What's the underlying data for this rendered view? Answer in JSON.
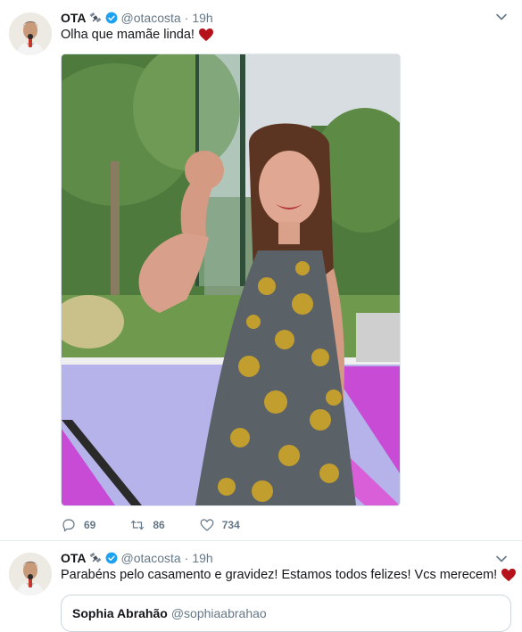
{
  "tweets": [
    {
      "name": "OTA",
      "handle": "@otacosta",
      "separator": "·",
      "time": "19h",
      "text": "Olha que mamãe linda!",
      "counts": {
        "replies": "69",
        "retweets": "86",
        "likes": "734"
      }
    },
    {
      "name": "OTA",
      "handle": "@otacosta",
      "separator": "·",
      "time": "19h",
      "text": "Parabéns pelo casamento e gravidez! Estamos todos felizes! Vcs merecem!",
      "quote": {
        "name": "Sophia Abrahão",
        "handle": "@sophiaabrahao"
      }
    }
  ],
  "colors": {
    "verified": "#1da1f2",
    "heart": "#b5121b",
    "meta": "#657786",
    "border": "#e6ecf0"
  },
  "icons": [
    "satellite-emoji-icon",
    "verified-badge-icon",
    "chevron-down-icon",
    "heart-emoji-icon",
    "reply-icon",
    "retweet-icon",
    "like-icon"
  ]
}
